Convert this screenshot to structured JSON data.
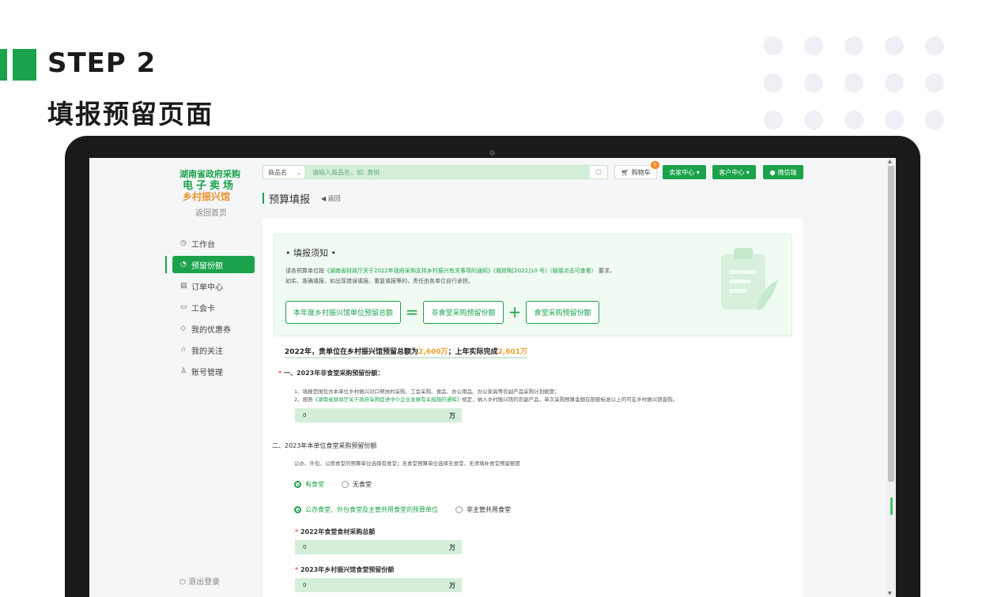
{
  "header": {
    "step": "STEP 2",
    "subtitle": "填报预留页面"
  },
  "sidebar": {
    "logo_line1": "湖南省政府采购",
    "logo_line2": "电子卖场",
    "logo_line3": "乡村振兴馆",
    "back_home": "返回首页",
    "items": [
      {
        "label": "工作台",
        "icon": "clock-icon"
      },
      {
        "label": "预留份额",
        "icon": "pie-icon"
      },
      {
        "label": "订单中心",
        "icon": "document-icon"
      },
      {
        "label": "工会卡",
        "icon": "card-icon"
      },
      {
        "label": "我的优惠券",
        "icon": "tag-icon"
      },
      {
        "label": "我的关注",
        "icon": "star-icon"
      },
      {
        "label": "账号管理",
        "icon": "user-icon"
      }
    ],
    "logout": "退出登录"
  },
  "topbar": {
    "search_category": "商品名",
    "search_placeholder": "请输入商品名，如: 黄桃",
    "cart_label": "购物车",
    "cart_count": "0",
    "seller_center": "卖家中心 ▾",
    "customer_center": "客户中心 ▾",
    "wechat": "微信端"
  },
  "page": {
    "title": "预算填报",
    "back": "返回"
  },
  "notice": {
    "title": "• 填报须知 •",
    "line1_pre": "请各预算单位按",
    "line1_link": "《湖南省财政厅关于2022年政府采购支持乡村振兴有关事项的通知》(湘财购[2022]10 号)（链接点击可查看）",
    "line1_post": "要求，",
    "line2": "如实、准确填报，如出现错误填报、重复填报等的，责任由各单位自行承担。",
    "formula_total": "本年度乡村振兴馆单位预留总额",
    "formula_eq": "=",
    "formula_a": "非食堂采购预留份额",
    "formula_plus": "+",
    "formula_b": "食堂采购预留份额"
  },
  "summary": {
    "pre": "2022年，贵单位在乡村振兴馆预留总额为",
    "total": "2,600万",
    "mid": "；上年实际完成",
    "done": "2,601万"
  },
  "section1": {
    "star": "*",
    "title": "一、2023年非食堂采购预留份额：",
    "note1": "1、填报范围包含本单位乡村振兴对口帮扶村采购、工会采购、食品、办公用品、办公家具等农副产品采购计划额度；",
    "note2_pre": "2、按照",
    "note2_link": "《湖南省财政厅关于政府采购促进中小企业发展有关措施的通知》",
    "note2_post": "规定，纳入乡村振兴馆的农副产品，单次采购预算金额在限额标准以上的可在乡村振兴馆直购。",
    "value": "0",
    "unit": "万"
  },
  "section2": {
    "title": "二、2023年本单位食堂采购预留份额",
    "note": "公办、外包、公用食堂的预算单位选择有食堂；无食堂预算单位选择无食堂，无须填补食堂预留额度",
    "opt_yes": "有食堂",
    "opt_no": "无食堂",
    "opt_type_a": "公办食堂、外包食堂及主管共用食堂的预算单位",
    "opt_type_b": "非主管共用食堂",
    "field1_label": "2022年食堂食材采购总额",
    "field1_value": "0",
    "field1_unit": "万",
    "field2_label": "2023年乡村振兴馆食堂预留份额",
    "field2_value": "0",
    "field2_unit": "万"
  }
}
